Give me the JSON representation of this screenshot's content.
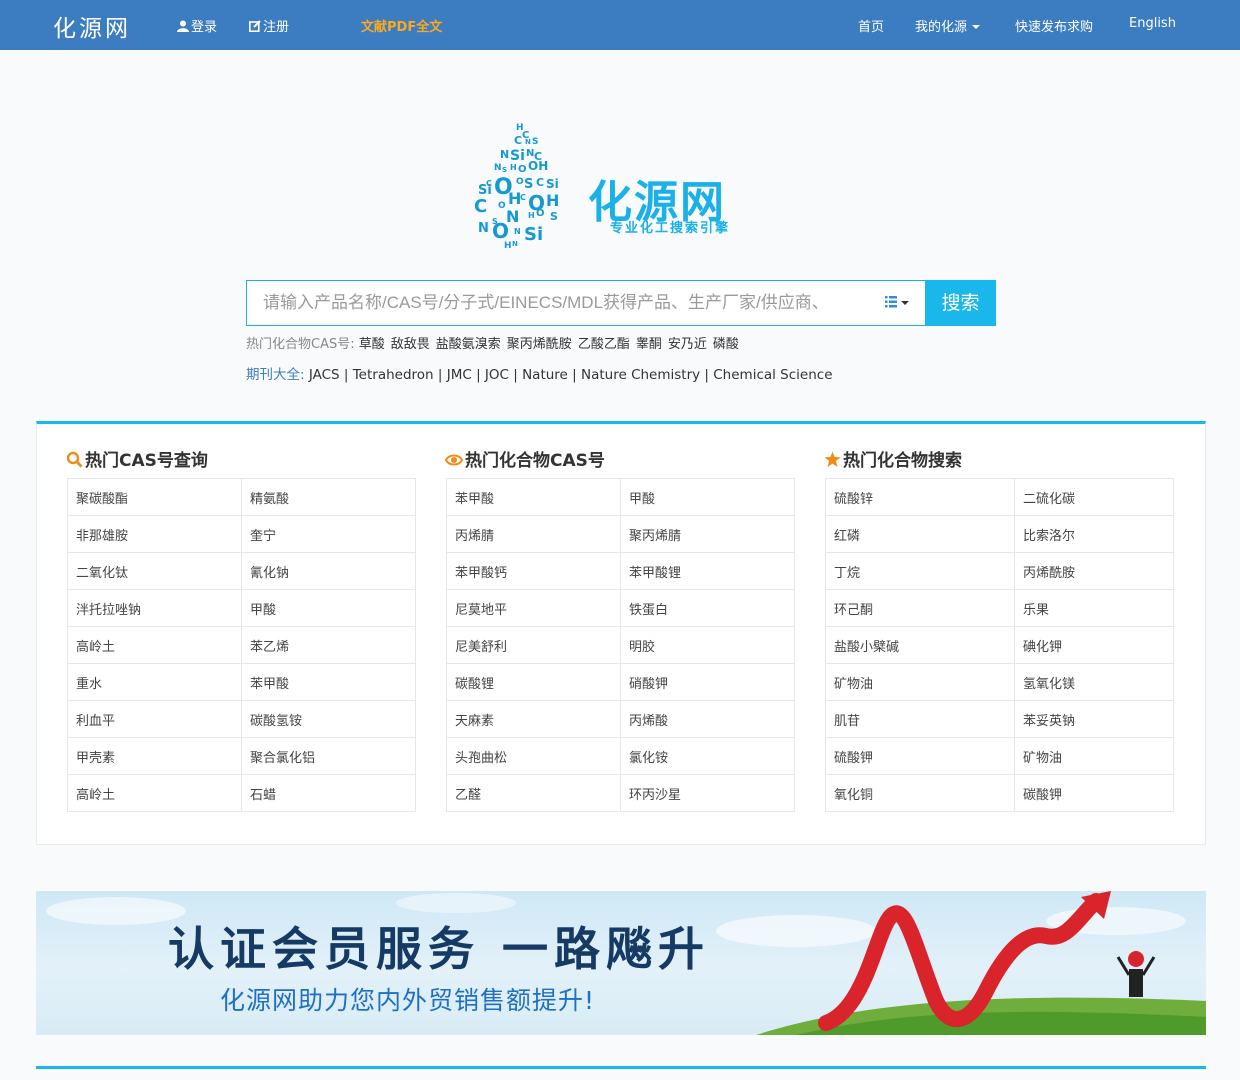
{
  "nav": {
    "brand": "化源网",
    "login": "登录",
    "register": "注册",
    "pdf": "文献PDF全文",
    "home": "首页",
    "my": "我的化源",
    "post": "快速发布求购",
    "english": "English"
  },
  "logo": {
    "name": "化源网",
    "tagline": "专业化工搜索引擎"
  },
  "search": {
    "placeholder": "请输入产品名称/CAS号/分子式/EINECS/MDL获得产品、生产厂家/供应商、",
    "button": "搜索"
  },
  "hot_cas": {
    "label": "热门化合物CAS号:",
    "items": [
      "草酸",
      "敌敌畏",
      "盐酸氨溴索",
      "聚丙烯酰胺",
      "乙酸乙酯",
      "睾酮",
      "安乃近",
      "磷酸"
    ]
  },
  "journals": {
    "label": "期刊大全:",
    "text": "JACS | Tetrahedron | JMC | JOC | Nature | Nature Chemistry | Chemical Science"
  },
  "columns": [
    {
      "title": "热门CAS号查询",
      "icon": "search-icon",
      "rows": [
        [
          "聚碳酸酯",
          "精氨酸"
        ],
        [
          "非那雄胺",
          "奎宁"
        ],
        [
          "二氧化钛",
          "氰化钠"
        ],
        [
          "泮托拉唑钠",
          "甲酸"
        ],
        [
          "高岭土",
          "苯乙烯"
        ],
        [
          "重水",
          "苯甲酸"
        ],
        [
          "利血平",
          "碳酸氢铵"
        ],
        [
          "甲壳素",
          "聚合氯化铝"
        ],
        [
          "高岭土",
          "石蜡"
        ]
      ]
    },
    {
      "title": "热门化合物CAS号",
      "icon": "eye-icon",
      "rows": [
        [
          "苯甲酸",
          "甲酸"
        ],
        [
          "丙烯腈",
          "聚丙烯腈"
        ],
        [
          "苯甲酸钙",
          "苯甲酸锂"
        ],
        [
          "尼莫地平",
          "铁蛋白"
        ],
        [
          "尼美舒利",
          "明胶"
        ],
        [
          "碳酸锂",
          "硝酸钾"
        ],
        [
          "天麻素",
          "丙烯酸"
        ],
        [
          "头孢曲松",
          "氯化铵"
        ],
        [
          "乙醛",
          "环丙沙星"
        ]
      ]
    },
    {
      "title": "热门化合物搜索",
      "icon": "star-icon",
      "rows": [
        [
          "硫酸锌",
          "二硫化碳"
        ],
        [
          "红磷",
          "比索洛尔"
        ],
        [
          "丁烷",
          "丙烯酰胺"
        ],
        [
          "环己酮",
          "乐果"
        ],
        [
          "盐酸小檗碱",
          "碘化钾"
        ],
        [
          "矿物油",
          "氢氧化镁"
        ],
        [
          "肌苷",
          "苯妥英钠"
        ],
        [
          "硫酸钾",
          "矿物油"
        ],
        [
          "氧化铜",
          "碳酸钾"
        ]
      ]
    }
  ],
  "banner": {
    "title": "认证会员服务 一路飚升",
    "subtitle": "化源网助力您内外贸销售额提升!"
  },
  "colors": {
    "nav_bg": "#3b7dc0",
    "accent": "#1ab8ea",
    "pdf_link": "#ffa81c",
    "icon_orange": "#f08c1a"
  }
}
